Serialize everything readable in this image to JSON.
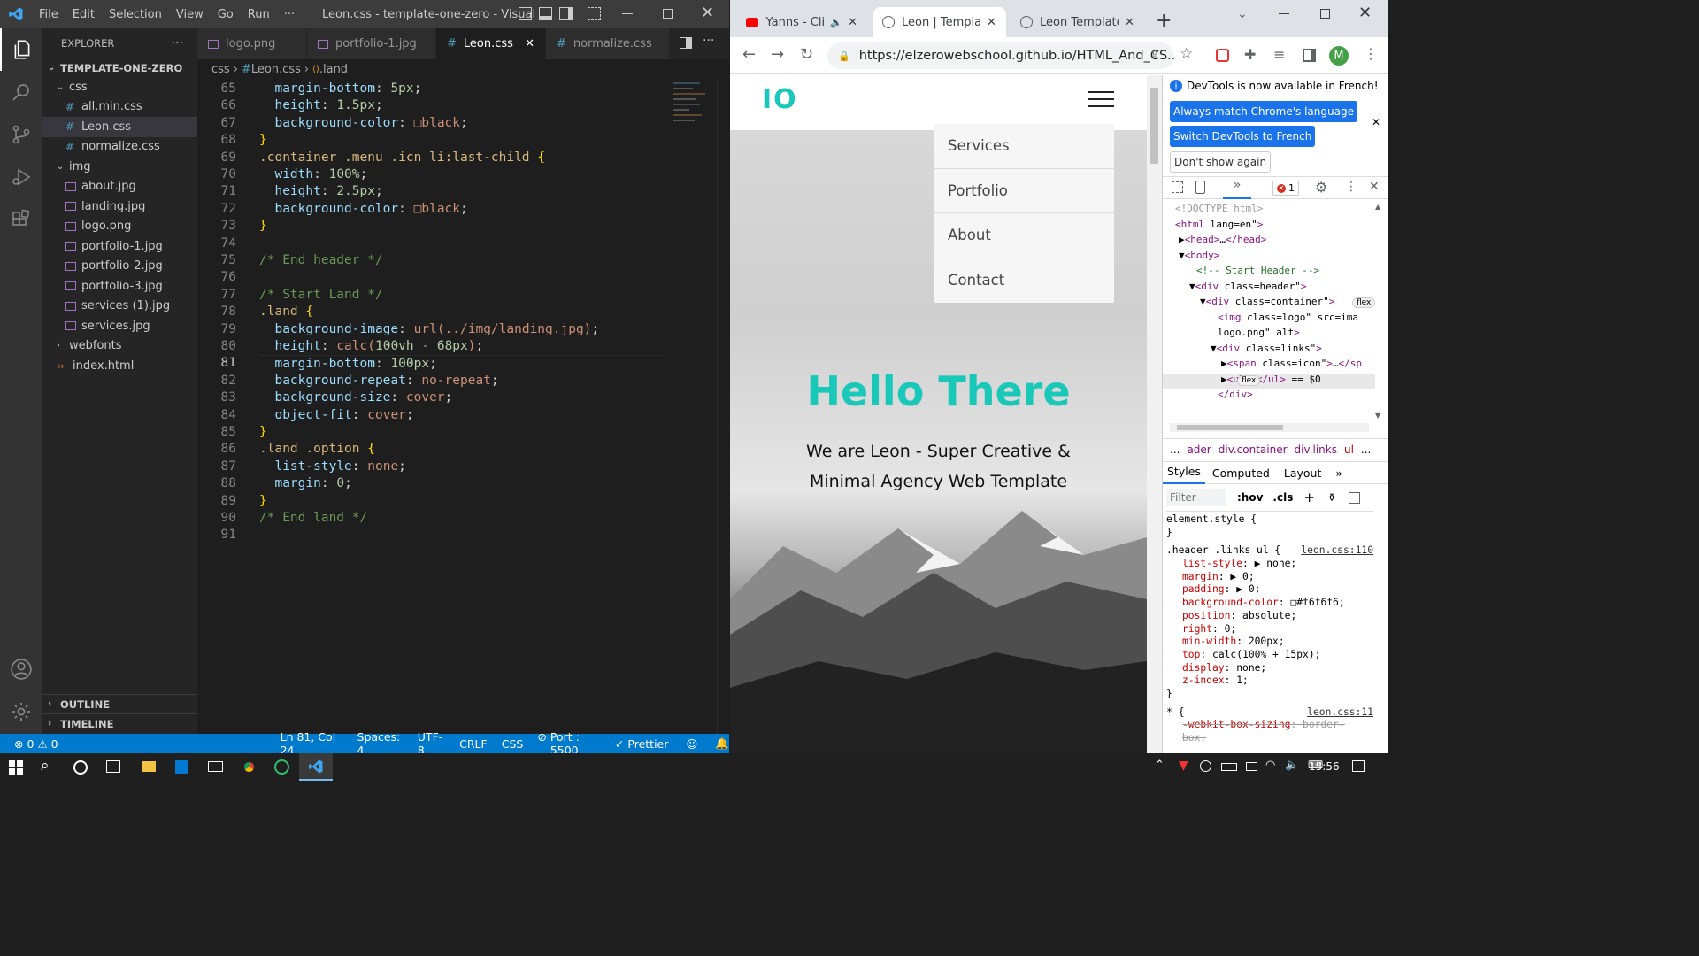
{
  "vscode": {
    "menu": [
      "File",
      "Edit",
      "Selection",
      "View",
      "Go",
      "Run",
      "···"
    ],
    "title": "Leon.css - template-one-zero - Visual ...",
    "explorer_title": "EXPLORER",
    "explorer_more": "···",
    "project": "TEMPLATE-ONE-ZERO",
    "tree": [
      {
        "label": "css",
        "type": "folder",
        "depth": 1,
        "open": true
      },
      {
        "label": "all.min.css",
        "type": "css",
        "depth": 2
      },
      {
        "label": "Leon.css",
        "type": "css",
        "depth": 2,
        "selected": true
      },
      {
        "label": "normalize.css",
        "type": "css",
        "depth": 2
      },
      {
        "label": "img",
        "type": "folder",
        "depth": 1,
        "open": true
      },
      {
        "label": "about.jpg",
        "type": "img",
        "depth": 2
      },
      {
        "label": "landing.jpg",
        "type": "img",
        "depth": 2
      },
      {
        "label": "logo.png",
        "type": "img",
        "depth": 2
      },
      {
        "label": "portfolio-1.jpg",
        "type": "img",
        "depth": 2
      },
      {
        "label": "portfolio-2.jpg",
        "type": "img",
        "depth": 2
      },
      {
        "label": "portfolio-3.jpg",
        "type": "img",
        "depth": 2
      },
      {
        "label": "services (1).jpg",
        "type": "img",
        "depth": 2
      },
      {
        "label": "services.jpg",
        "type": "img",
        "depth": 2
      },
      {
        "label": "webfonts",
        "type": "folder",
        "depth": 1,
        "open": false
      },
      {
        "label": "index.html",
        "type": "html",
        "depth": 1
      }
    ],
    "outline": "OUTLINE",
    "timeline": "TIMELINE",
    "tabs": [
      {
        "label": "logo.png",
        "type": "img"
      },
      {
        "label": "portfolio-1.jpg",
        "type": "img"
      },
      {
        "label": "Leon.css",
        "type": "css",
        "active": true
      },
      {
        "label": "normalize.css",
        "type": "css"
      }
    ],
    "breadcrumb": [
      "css",
      "Leon.css",
      ".land"
    ],
    "code": [
      {
        "n": "65",
        "t": "  margin-bottom: 5px;"
      },
      {
        "n": "66",
        "t": "  height: 1.5px;"
      },
      {
        "n": "67",
        "t": "  background-color: □black;"
      },
      {
        "n": "68",
        "t": "}"
      },
      {
        "n": "69",
        "t": ".container .menu .icn li:last-child {"
      },
      {
        "n": "70",
        "t": "  width: 100%;"
      },
      {
        "n": "71",
        "t": "  height: 2.5px;"
      },
      {
        "n": "72",
        "t": "  background-color: □black;"
      },
      {
        "n": "73",
        "t": "}"
      },
      {
        "n": "74",
        "t": ""
      },
      {
        "n": "75",
        "t": "/* End header */"
      },
      {
        "n": "76",
        "t": ""
      },
      {
        "n": "77",
        "t": "/* Start Land */"
      },
      {
        "n": "78",
        "t": ".land {"
      },
      {
        "n": "79",
        "t": "  background-image: url(../img/landing.jpg);"
      },
      {
        "n": "80",
        "t": "  height: calc(100vh - 68px);"
      },
      {
        "n": "81",
        "t": "  margin-bottom: 100px;"
      },
      {
        "n": "82",
        "t": "  background-repeat: no-repeat;"
      },
      {
        "n": "83",
        "t": "  background-size: cover;"
      },
      {
        "n": "84",
        "t": "  object-fit: cover;"
      },
      {
        "n": "85",
        "t": "}"
      },
      {
        "n": "86",
        "t": ".land .option {"
      },
      {
        "n": "87",
        "t": "  list-style: none;"
      },
      {
        "n": "88",
        "t": "  margin: 0;"
      },
      {
        "n": "89",
        "t": "}"
      },
      {
        "n": "90",
        "t": "/* End land */"
      },
      {
        "n": "91",
        "t": ""
      }
    ],
    "status": {
      "errors": "0",
      "warnings": "0",
      "position": "Ln 81, Col 24",
      "spaces": "Spaces: 4",
      "encoding": "UTF-8",
      "eol": "CRLF",
      "lang": "CSS",
      "port": "Port : 5500",
      "prettier": "Prettier"
    }
  },
  "chrome": {
    "tabs": [
      "Yanns - Clic",
      "Leon | Template",
      "Leon Template C"
    ],
    "url": "https://elzerowebschool.github.io/HTML_And_CS...",
    "profile": "M",
    "page": {
      "logo": "IO",
      "menu": [
        "Services",
        "Portfolio",
        "About",
        "Contact"
      ],
      "heading": "Hello There",
      "subtitle_1": "We are Leon - Super Creative &",
      "subtitle_2": "Minimal Agency Web Template"
    },
    "devtools": {
      "notice": "DevTools is now available in French!",
      "btn_match": "Always match Chrome's language",
      "btn_switch": "Switch DevTools to French",
      "btn_dont": "Don't show again",
      "error_count": "1",
      "dom": [
        "<!DOCTYPE html>",
        "<html lang=\"en\">",
        "▶<head>…</head>",
        "▼<body>",
        "<!-- Start Header -->",
        "▼<div class=\"header\">",
        "▼<div class=\"container\">",
        "<img class=\"logo\" src=\"ima",
        "logo.png\" alt>",
        "▼<div class=\"links\">",
        "▶<span class=\"icon\">…</sp",
        "▶<ul>…</ul> == $0",
        "</div>"
      ],
      "flex_badge": "flex",
      "crumbs": [
        "...",
        "ader",
        "div.container",
        "div.links",
        "ul",
        "..."
      ],
      "panes": [
        "Styles",
        "Computed",
        "Layout",
        "»"
      ],
      "filter": "Filter",
      "hov": ":hov",
      "cls": ".cls",
      "rules": [
        {
          "sel": "element.style {",
          "src": ""
        },
        {
          "sel": "}",
          "src": ""
        },
        {
          "sel": ".header .links ul {",
          "src": "leon.css:110"
        },
        {
          "prop": "list-style",
          "val": "▶ none;"
        },
        {
          "prop": "margin",
          "val": "▶ 0;"
        },
        {
          "prop": "padding",
          "val": "▶ 0;"
        },
        {
          "prop": "background-color",
          "val": "□#f6f6f6;"
        },
        {
          "prop": "position",
          "val": "absolute;"
        },
        {
          "prop": "right",
          "val": "0;"
        },
        {
          "prop": "min-width",
          "val": "200px;"
        },
        {
          "prop": "top",
          "val": "calc(100% + 15px);"
        },
        {
          "prop": "display",
          "val": "none;"
        },
        {
          "prop": "z-index",
          "val": "1;"
        },
        {
          "sel": "}",
          "src": ""
        },
        {
          "sel": "* {",
          "src": "leon.css:11"
        },
        {
          "prop": "-webkit-box-sizing",
          "val": "border-",
          "strike": true
        },
        {
          "sel": "box;",
          "src": "",
          "strike": true
        }
      ]
    }
  },
  "taskbar": {
    "time": "15:56"
  },
  "colors": {
    "teal": "#19c8b9",
    "vscode_blue": "#007acc"
  }
}
